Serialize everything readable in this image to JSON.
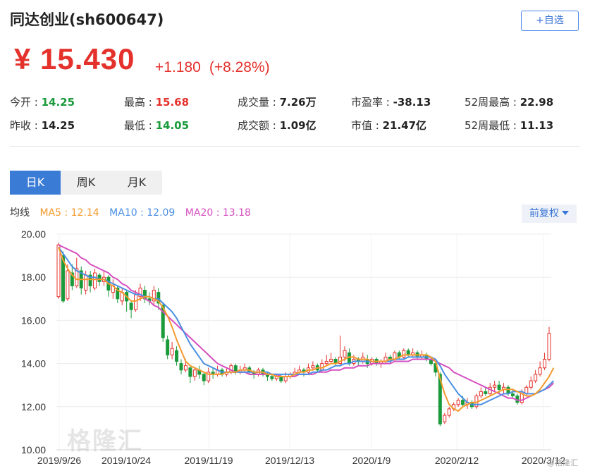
{
  "header": {
    "title": "同达创业(sh600647)",
    "fav_button": "+自选"
  },
  "quote": {
    "currency": "¥",
    "price": "15.430",
    "change": "+1.180",
    "change_pct": "(+8.28%)"
  },
  "stats": {
    "open_label": "今开 : ",
    "open_value": "14.25",
    "prev_close_label": "昨收 : ",
    "prev_close_value": "14.25",
    "high_label": "最高 : ",
    "high_value": "15.68",
    "low_label": "最低 : ",
    "low_value": "14.05",
    "volume_label": "成交量 : ",
    "volume_value": "7.26万",
    "turnover_label": "成交额 : ",
    "turnover_value": "1.09亿",
    "pe_label": "市盈率 : ",
    "pe_value": "-38.13",
    "mktcap_label": "市值 : ",
    "mktcap_value": "21.47亿",
    "wk52_high_label": "52周最高 : ",
    "wk52_high_value": "22.98",
    "wk52_low_label": "52周最低 : ",
    "wk52_low_value": "11.13"
  },
  "tabs": [
    "日K",
    "周K",
    "月K"
  ],
  "ma": {
    "label": "均线",
    "ma5": "MA5 : 12.14",
    "ma10": "MA10 : 12.09",
    "ma20": "MA20 : 13.18"
  },
  "adjust_button": "前复权",
  "watermark": "格隆汇",
  "corner_text": "@格隆汇",
  "colors": {
    "up": "#e4312b",
    "down": "#1a9a3b",
    "ma5": "#f39a2c",
    "ma10": "#4a8fe3",
    "ma20": "#d64fbf",
    "accent": "#3a7bd5"
  },
  "chart_data": {
    "type": "candlestick",
    "ylim": [
      10,
      20
    ],
    "y_ticks": [
      "20.00",
      "18.00",
      "16.00",
      "14.00",
      "12.00",
      "10.00"
    ],
    "x_ticks": [
      "2019/9/26",
      "2019/10/24",
      "2019/11/19",
      "2019/12/13",
      "2020/1/9",
      "2020/2/12",
      "2020/3/12"
    ],
    "candles": [
      [
        17.1,
        19.5,
        19.6,
        17.0
      ],
      [
        19.0,
        16.9,
        19.2,
        16.8
      ],
      [
        17.0,
        18.3,
        18.6,
        16.9
      ],
      [
        18.2,
        17.6,
        18.6,
        17.4
      ],
      [
        17.6,
        18.4,
        18.9,
        17.5
      ],
      [
        18.3,
        17.5,
        18.5,
        17.2
      ],
      [
        17.4,
        18.1,
        18.3,
        17.2
      ],
      [
        18.1,
        17.6,
        18.3,
        17.3
      ],
      [
        17.5,
        18.2,
        18.4,
        17.4
      ],
      [
        18.1,
        17.8,
        18.2,
        17.6
      ],
      [
        17.8,
        18.0,
        18.3,
        17.6
      ],
      [
        18.0,
        17.4,
        18.1,
        17.1
      ],
      [
        17.3,
        17.6,
        17.9,
        17.0
      ],
      [
        17.5,
        17.0,
        17.6,
        16.8
      ],
      [
        16.9,
        17.3,
        17.5,
        16.7
      ],
      [
        17.3,
        16.9,
        17.4,
        16.4
      ],
      [
        16.8,
        16.5,
        16.9,
        16.1
      ],
      [
        16.5,
        17.2,
        17.4,
        16.4
      ],
      [
        17.1,
        17.5,
        17.7,
        16.9
      ],
      [
        17.4,
        17.0,
        17.6,
        16.8
      ],
      [
        17.0,
        16.9,
        17.3,
        16.7
      ],
      [
        16.9,
        17.4,
        17.6,
        16.7
      ],
      [
        17.3,
        16.8,
        17.5,
        16.5
      ],
      [
        16.7,
        15.2,
        16.8,
        15.0
      ],
      [
        15.1,
        14.4,
        15.3,
        14.2
      ],
      [
        14.4,
        14.7,
        15.0,
        14.2
      ],
      [
        14.6,
        14.1,
        14.8,
        13.9
      ],
      [
        14.0,
        13.7,
        14.2,
        13.5
      ],
      [
        13.7,
        13.9,
        14.2,
        13.6
      ],
      [
        13.8,
        13.4,
        13.9,
        13.1
      ],
      [
        13.4,
        13.7,
        13.8,
        13.2
      ],
      [
        13.7,
        13.5,
        13.9,
        13.3
      ],
      [
        13.5,
        13.2,
        13.6,
        13.0
      ],
      [
        13.2,
        13.6,
        13.8,
        13.1
      ],
      [
        13.6,
        13.5,
        13.8,
        13.3
      ],
      [
        13.5,
        13.7,
        13.9,
        13.4
      ],
      [
        13.7,
        13.5,
        13.8,
        13.4
      ],
      [
        13.5,
        13.6,
        13.8,
        13.4
      ],
      [
        13.6,
        13.9,
        14.0,
        13.5
      ],
      [
        13.9,
        13.6,
        14.0,
        13.5
      ],
      [
        13.6,
        13.7,
        13.9,
        13.5
      ],
      [
        13.7,
        13.8,
        14.0,
        13.6
      ],
      [
        13.8,
        13.6,
        13.9,
        13.5
      ],
      [
        13.6,
        13.5,
        13.7,
        13.3
      ],
      [
        13.5,
        13.7,
        13.8,
        13.4
      ],
      [
        13.7,
        13.5,
        13.8,
        13.4
      ],
      [
        13.5,
        13.4,
        13.6,
        13.2
      ],
      [
        13.4,
        13.3,
        13.5,
        13.2
      ],
      [
        13.3,
        13.4,
        13.5,
        13.2
      ],
      [
        13.4,
        13.2,
        13.5,
        13.1
      ],
      [
        13.2,
        13.4,
        13.6,
        13.1
      ],
      [
        13.4,
        13.5,
        13.6,
        13.3
      ],
      [
        13.5,
        13.6,
        13.8,
        13.4
      ],
      [
        13.6,
        13.7,
        13.9,
        13.5
      ],
      [
        13.7,
        13.6,
        13.8,
        13.4
      ],
      [
        13.6,
        13.8,
        14.0,
        13.5
      ],
      [
        13.8,
        13.9,
        14.1,
        13.7
      ],
      [
        13.9,
        13.7,
        14.0,
        13.6
      ],
      [
        13.7,
        14.0,
        14.2,
        13.6
      ],
      [
        14.0,
        14.1,
        14.4,
        13.9
      ],
      [
        14.1,
        14.2,
        14.5,
        14.0
      ],
      [
        14.2,
        14.0,
        14.3,
        13.9
      ],
      [
        14.0,
        14.3,
        15.3,
        13.9
      ],
      [
        14.3,
        14.6,
        14.8,
        14.1
      ],
      [
        14.5,
        14.0,
        14.7,
        13.9
      ],
      [
        14.0,
        14.2,
        14.4,
        13.9
      ],
      [
        14.2,
        14.1,
        14.3,
        13.9
      ],
      [
        14.1,
        14.3,
        14.5,
        14.0
      ],
      [
        14.2,
        14.0,
        14.4,
        13.8
      ],
      [
        14.0,
        14.2,
        14.3,
        13.9
      ],
      [
        14.2,
        14.0,
        14.3,
        13.9
      ],
      [
        14.0,
        14.1,
        14.2,
        13.8
      ],
      [
        14.1,
        14.3,
        14.5,
        14.0
      ],
      [
        14.3,
        14.2,
        14.4,
        14.0
      ],
      [
        14.2,
        14.5,
        14.6,
        14.1
      ],
      [
        14.5,
        14.3,
        14.6,
        14.2
      ],
      [
        14.3,
        14.6,
        14.7,
        14.2
      ],
      [
        14.6,
        14.4,
        14.7,
        14.3
      ],
      [
        14.4,
        14.5,
        14.7,
        14.3
      ],
      [
        14.5,
        14.3,
        14.6,
        14.2
      ],
      [
        14.3,
        14.4,
        14.6,
        14.2
      ],
      [
        14.4,
        14.2,
        14.5,
        14.1
      ],
      [
        14.2,
        14.0,
        14.3,
        13.9
      ],
      [
        14.0,
        13.6,
        14.1,
        13.4
      ],
      [
        13.5,
        11.2,
        13.6,
        11.1
      ],
      [
        11.3,
        11.6,
        11.7,
        11.2
      ],
      [
        11.6,
        11.9,
        12.0,
        11.5
      ],
      [
        11.9,
        12.1,
        12.2,
        11.8
      ],
      [
        12.1,
        12.3,
        12.4,
        12.0
      ],
      [
        12.3,
        12.1,
        12.5,
        12.0
      ],
      [
        12.1,
        12.2,
        12.4,
        11.9
      ],
      [
        12.2,
        12.0,
        12.3,
        11.9
      ],
      [
        12.0,
        12.5,
        12.6,
        11.9
      ],
      [
        12.5,
        12.7,
        12.9,
        12.4
      ],
      [
        12.7,
        12.6,
        12.9,
        12.5
      ],
      [
        12.6,
        12.9,
        13.1,
        12.5
      ],
      [
        12.9,
        13.0,
        13.2,
        12.7
      ],
      [
        13.0,
        12.8,
        13.2,
        12.6
      ],
      [
        12.8,
        12.9,
        13.1,
        12.6
      ],
      [
        12.9,
        12.6,
        13.0,
        12.5
      ],
      [
        12.6,
        12.5,
        12.8,
        12.4
      ],
      [
        12.5,
        12.2,
        12.6,
        12.1
      ],
      [
        12.2,
        12.6,
        12.8,
        12.1
      ],
      [
        12.6,
        12.9,
        13.0,
        12.5
      ],
      [
        12.9,
        13.2,
        13.4,
        12.8
      ],
      [
        13.2,
        13.5,
        13.7,
        13.1
      ],
      [
        13.5,
        13.8,
        14.1,
        13.4
      ],
      [
        13.8,
        14.2,
        14.5,
        13.7
      ],
      [
        14.2,
        15.4,
        15.7,
        14.1
      ]
    ],
    "ma5": [
      19.4,
      18.8,
      18.4,
      18.1,
      17.9,
      17.9,
      17.9,
      17.9,
      17.9,
      17.9,
      17.9,
      17.7,
      17.6,
      17.4,
      17.3,
      17.1,
      16.9,
      16.9,
      17.0,
      17.1,
      17.1,
      17.0,
      16.9,
      16.6,
      16.2,
      15.7,
      15.1,
      14.6,
      14.1,
      13.9,
      13.8,
      13.7,
      13.6,
      13.5,
      13.5,
      13.5,
      13.5,
      13.6,
      13.6,
      13.6,
      13.7,
      13.7,
      13.7,
      13.6,
      13.6,
      13.6,
      13.5,
      13.5,
      13.4,
      13.4,
      13.4,
      13.4,
      13.5,
      13.6,
      13.6,
      13.7,
      13.7,
      13.8,
      13.8,
      13.9,
      14.0,
      14.0,
      14.1,
      14.2,
      14.3,
      14.3,
      14.2,
      14.2,
      14.2,
      14.1,
      14.1,
      14.1,
      14.1,
      14.2,
      14.2,
      14.3,
      14.4,
      14.4,
      14.4,
      14.4,
      14.4,
      14.4,
      14.3,
      14.1,
      13.3,
      12.6,
      12.1,
      11.9,
      11.8,
      12.0,
      12.1,
      12.2,
      12.2,
      12.3,
      12.4,
      12.5,
      12.6,
      12.7,
      12.8,
      12.8,
      12.8,
      12.7,
      12.6,
      12.5,
      12.5,
      12.6,
      12.8,
      13.1,
      13.4,
      13.8
    ],
    "ma10": [
      19.4,
      19.1,
      18.8,
      18.5,
      18.3,
      18.2,
      18.1,
      18.0,
      18.0,
      17.9,
      17.9,
      17.8,
      17.7,
      17.6,
      17.5,
      17.4,
      17.3,
      17.2,
      17.2,
      17.1,
      17.1,
      17.0,
      17.0,
      16.8,
      16.6,
      16.4,
      16.1,
      15.7,
      15.3,
      14.9,
      14.6,
      14.3,
      14.0,
      13.9,
      13.8,
      13.7,
      13.6,
      13.6,
      13.6,
      13.6,
      13.6,
      13.6,
      13.6,
      13.6,
      13.6,
      13.6,
      13.6,
      13.5,
      13.5,
      13.5,
      13.5,
      13.5,
      13.5,
      13.5,
      13.5,
      13.5,
      13.6,
      13.6,
      13.7,
      13.7,
      13.8,
      13.9,
      13.9,
      14.0,
      14.0,
      14.1,
      14.1,
      14.1,
      14.1,
      14.1,
      14.1,
      14.1,
      14.1,
      14.1,
      14.2,
      14.2,
      14.2,
      14.3,
      14.3,
      14.3,
      14.3,
      14.3,
      14.3,
      14.2,
      13.9,
      13.5,
      13.2,
      12.9,
      12.6,
      12.4,
      12.2,
      12.1,
      12.1,
      12.1,
      12.2,
      12.3,
      12.4,
      12.5,
      12.6,
      12.6,
      12.7,
      12.7,
      12.7,
      12.6,
      12.6,
      12.6,
      12.7,
      12.8,
      13.0,
      13.2
    ],
    "ma20": [
      19.5,
      19.4,
      19.3,
      19.2,
      19.1,
      18.9,
      18.8,
      18.6,
      18.5,
      18.4,
      18.3,
      18.2,
      18.0,
      17.9,
      17.7,
      17.6,
      17.4,
      17.3,
      17.2,
      17.0,
      16.9,
      16.7,
      16.6,
      16.4,
      16.2,
      16.0,
      15.8,
      15.6,
      15.4,
      15.2,
      15.0,
      14.8,
      14.6,
      14.4,
      14.2,
      14.0,
      13.9,
      13.8,
      13.7,
      13.6,
      13.6,
      13.6,
      13.5,
      13.5,
      13.5,
      13.5,
      13.5,
      13.5,
      13.5,
      13.4,
      13.4,
      13.4,
      13.4,
      13.5,
      13.5,
      13.5,
      13.5,
      13.6,
      13.6,
      13.6,
      13.7,
      13.7,
      13.7,
      13.8,
      13.8,
      13.8,
      13.9,
      13.9,
      13.9,
      14.0,
      14.0,
      14.0,
      14.0,
      14.0,
      14.1,
      14.1,
      14.1,
      14.1,
      14.2,
      14.2,
      14.2,
      14.2,
      14.2,
      14.1,
      14.0,
      13.9,
      13.8,
      13.6,
      13.5,
      13.4,
      13.3,
      13.2,
      13.1,
      13.0,
      12.9,
      12.8,
      12.7,
      12.6,
      12.5,
      12.4,
      12.4,
      12.3,
      12.3,
      12.4,
      12.5,
      12.6,
      12.7,
      12.8,
      12.9,
      13.1
    ]
  }
}
